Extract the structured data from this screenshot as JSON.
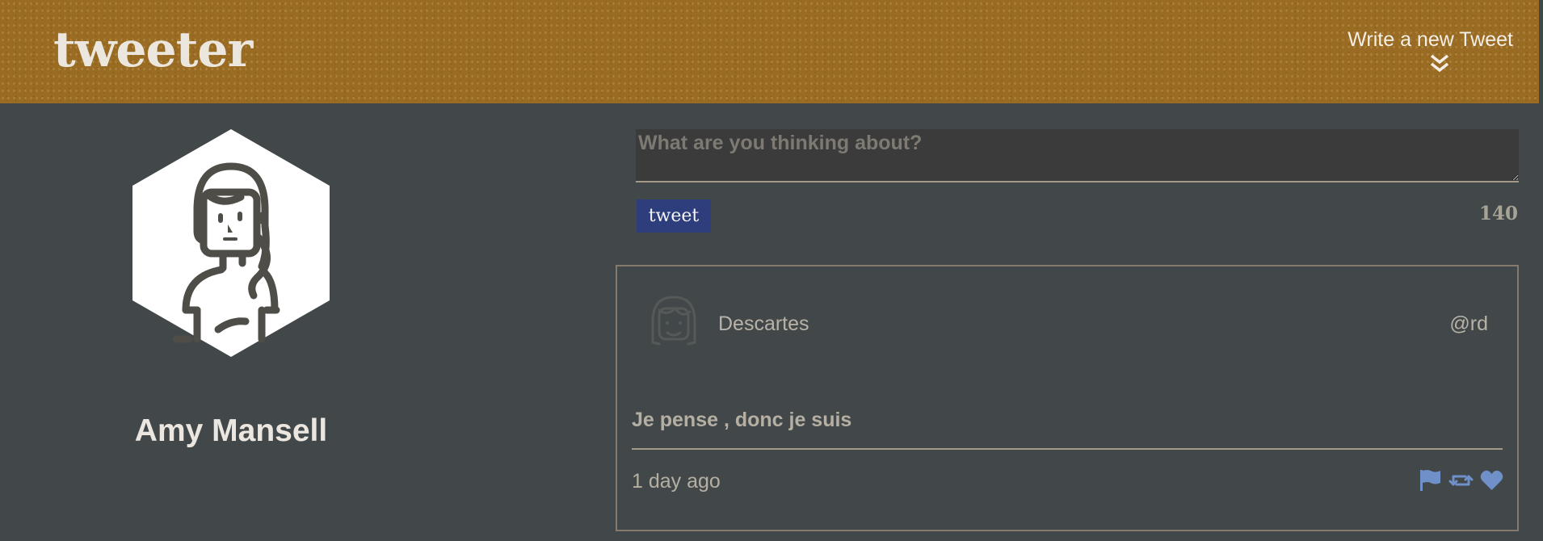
{
  "header": {
    "brand": "tweeter",
    "compose_toggle_label": "Write a new Tweet",
    "compose_toggle_icon": "double-chevron-down-icon"
  },
  "profile": {
    "name": "Amy Mansell",
    "avatar_icon": "woman-avatar-icon"
  },
  "composer": {
    "placeholder": "What are you thinking about?",
    "value": "",
    "submit_label": "tweet",
    "char_count": "140"
  },
  "tweets": [
    {
      "author": "Descartes",
      "handle": "@rd",
      "avatar_icon": "woman-avatar-icon",
      "text": "Je pense , donc je suis",
      "time": "1 day ago",
      "actions": [
        "flag-icon",
        "retweet-icon",
        "heart-icon"
      ]
    }
  ],
  "colors": {
    "header_bg": "#9a6b22",
    "page_bg": "#424849",
    "tweet_button": "#2e3e7c",
    "action_icons": "#6f90c9"
  }
}
